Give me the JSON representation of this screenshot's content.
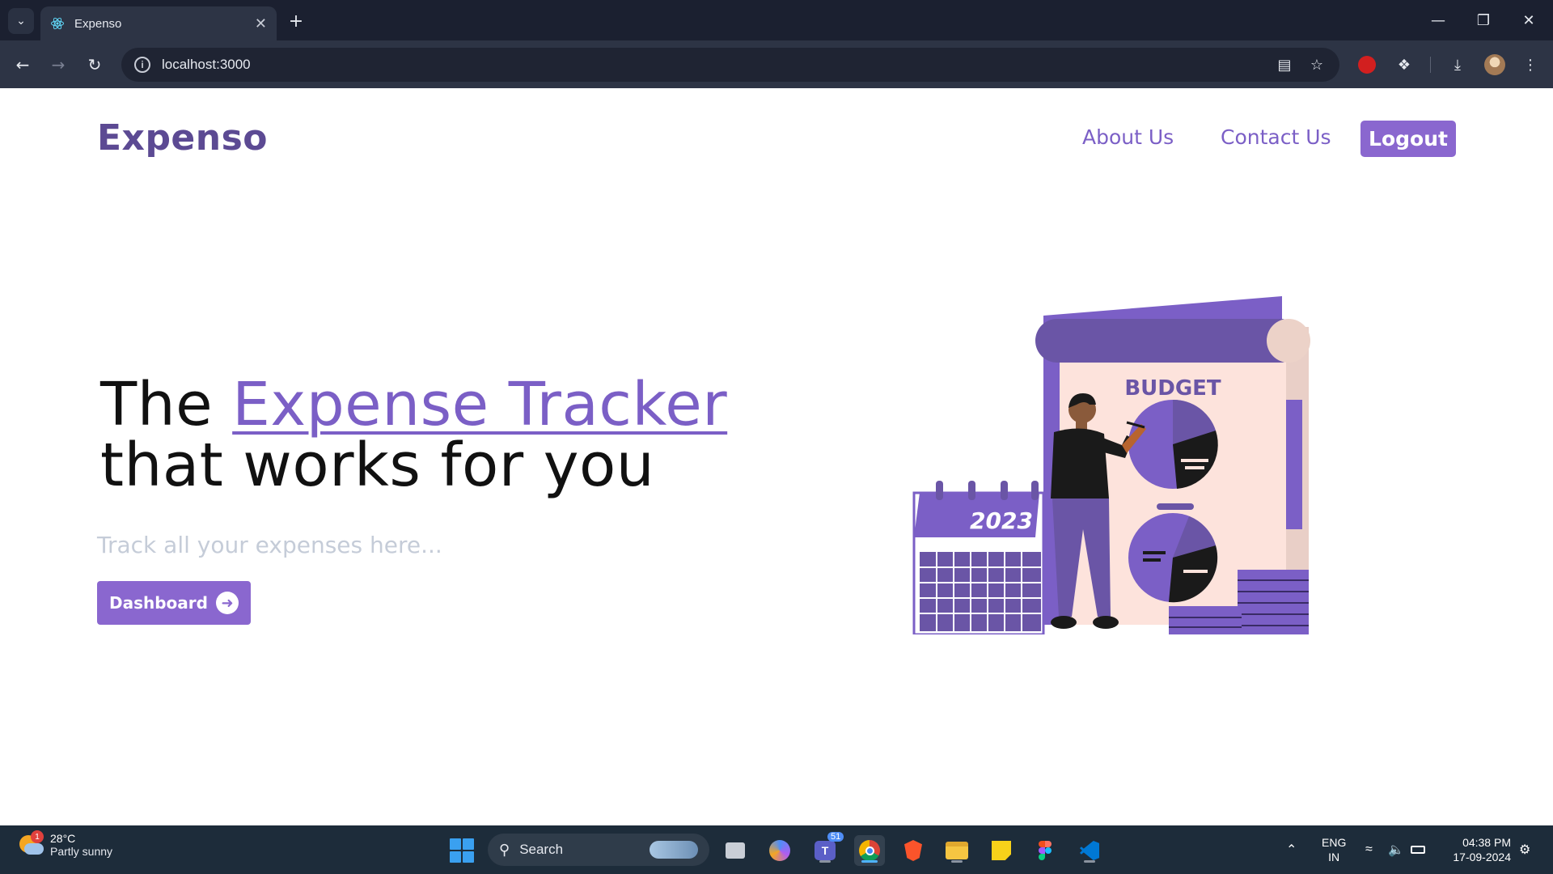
{
  "browser": {
    "tab_title": "Expenso",
    "url": "localhost:3000"
  },
  "header": {
    "brand": "Expenso",
    "nav": [
      {
        "label": "About Us"
      },
      {
        "label": "Contact Us"
      }
    ],
    "logout_label": "Logout"
  },
  "hero": {
    "line1_prefix": "The ",
    "line1_accent": "Expense Tracker",
    "line2": "that works for you",
    "subtitle": "Track all your expenses here...",
    "cta_label": "Dashboard",
    "illustration": {
      "heading": "BUDGET",
      "calendar_year": "2023"
    }
  },
  "taskbar": {
    "weather_temp": "28°C",
    "weather_desc": "Partly sunny",
    "weather_badge": "1",
    "search_placeholder": "Search",
    "teams_badge": "51",
    "language": "ENG",
    "region": "IN",
    "time": "04:38 PM",
    "date": "17-09-2024"
  },
  "colors": {
    "brand": "#5c4a93",
    "accent": "#8a67cf",
    "link": "#7b5fc6",
    "subtitle": "#c5ccd8"
  }
}
